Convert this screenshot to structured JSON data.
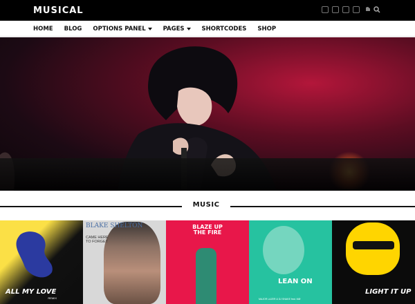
{
  "header": {
    "logo": "MUSICAL",
    "social_icons": [
      "facebook-icon",
      "twitter-icon",
      "instagram-icon",
      "youtube-icon",
      "soundcloud-icon",
      "search-icon"
    ]
  },
  "nav": {
    "items": [
      {
        "label": "HOME",
        "has_dropdown": false
      },
      {
        "label": "BLOG",
        "has_dropdown": false
      },
      {
        "label": "OPTIONS PANEL",
        "has_dropdown": true
      },
      {
        "label": "PAGES",
        "has_dropdown": true
      },
      {
        "label": "SHORTCODES",
        "has_dropdown": false
      },
      {
        "label": "SHOP",
        "has_dropdown": false
      }
    ]
  },
  "hero": {
    "image": "concert-singer-photo"
  },
  "music": {
    "title": "MUSIC",
    "albums": [
      {
        "title": "ALL MY LOVE",
        "subtitle": "REMIX"
      },
      {
        "artist": "BLAKE SHELTON",
        "title": "CAME HERE TO FORGET"
      },
      {
        "title": "BLAZE UP THE FIRE"
      },
      {
        "title": "LEAN ON",
        "subtitle": "MAJOR LAZER & DJ SNAKE feat. MØ"
      },
      {
        "title": "LIGHT IT UP"
      }
    ]
  },
  "colors": {
    "topbar": "#000000",
    "accent_red": "#e8174a",
    "accent_teal": "#26c2a0",
    "accent_yellow": "#ffd500"
  }
}
